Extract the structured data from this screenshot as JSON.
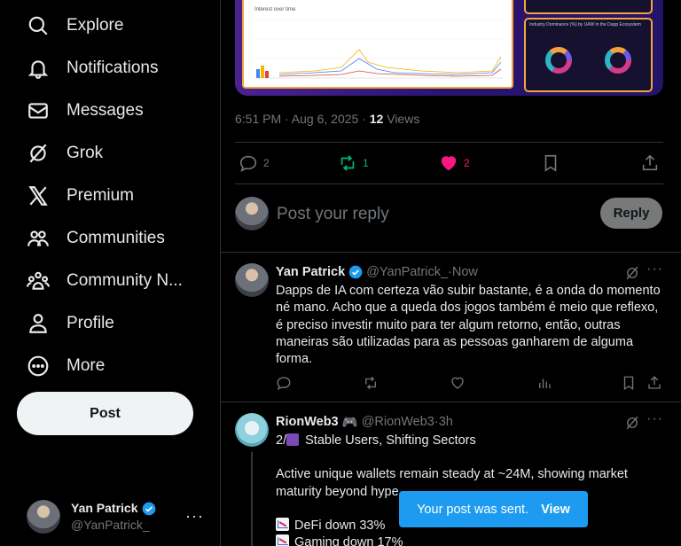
{
  "sidebar": {
    "items": [
      {
        "label": "Explore",
        "icon": "search-icon"
      },
      {
        "label": "Notifications",
        "icon": "bell-icon"
      },
      {
        "label": "Messages",
        "icon": "envelope-icon"
      },
      {
        "label": "Grok",
        "icon": "grok-icon"
      },
      {
        "label": "Premium",
        "icon": "x-logo-icon"
      },
      {
        "label": "Communities",
        "icon": "people-icon"
      },
      {
        "label": "Community N...",
        "icon": "community-notes-icon"
      },
      {
        "label": "Profile",
        "icon": "person-icon"
      },
      {
        "label": "More",
        "icon": "more-circle-icon"
      }
    ],
    "post_label": "Post",
    "account": {
      "name": "Yan Patrick",
      "handle": "@YanPatrick_"
    }
  },
  "post": {
    "embed": {
      "chart_title": "Interest over time",
      "dashboard_title": "Industry Dominance (%) by UAW in the Dapp Ecosystem"
    },
    "time": "6:51 PM · Aug 6, 2025 · ",
    "views_count": "12",
    "views_label": " Views",
    "stats": {
      "replies": "2",
      "reposts": "1",
      "likes": "2"
    },
    "colors": {
      "repost": "#00ba7c",
      "like": "#f91880",
      "accent": "#1d9bf0"
    }
  },
  "reply": {
    "placeholder": "Post your reply",
    "button": "Reply"
  },
  "tweets": [
    {
      "name": "Yan Patrick",
      "handle": "@YanPatrick_",
      "sep": " · ",
      "time": "Now",
      "text": "Dapps de IA com certeza vão subir bastante, é a onda do momento né mano. Acho que a queda dos jogos também é meio que reflexo, é preciso investir muito para ter algum retorno, então, outras maneiras são utilizadas para as pessoas ganharem de alguma forma."
    },
    {
      "name": "RionWeb3",
      "name_emoji": "🎮",
      "handle": "@RionWeb3",
      "sep": " · ",
      "time": "3h",
      "line1_prefix": "2/",
      "line1": "Stable Users, Shifting Sectors",
      "line2": "Active unique wallets remain steady at ~24M, showing market maturity beyond hype.",
      "bullet1": "DeFi down 33%",
      "bullet2": "Gaming down 17%"
    }
  ],
  "toast": {
    "text": "Your post was sent.",
    "action": "View"
  }
}
